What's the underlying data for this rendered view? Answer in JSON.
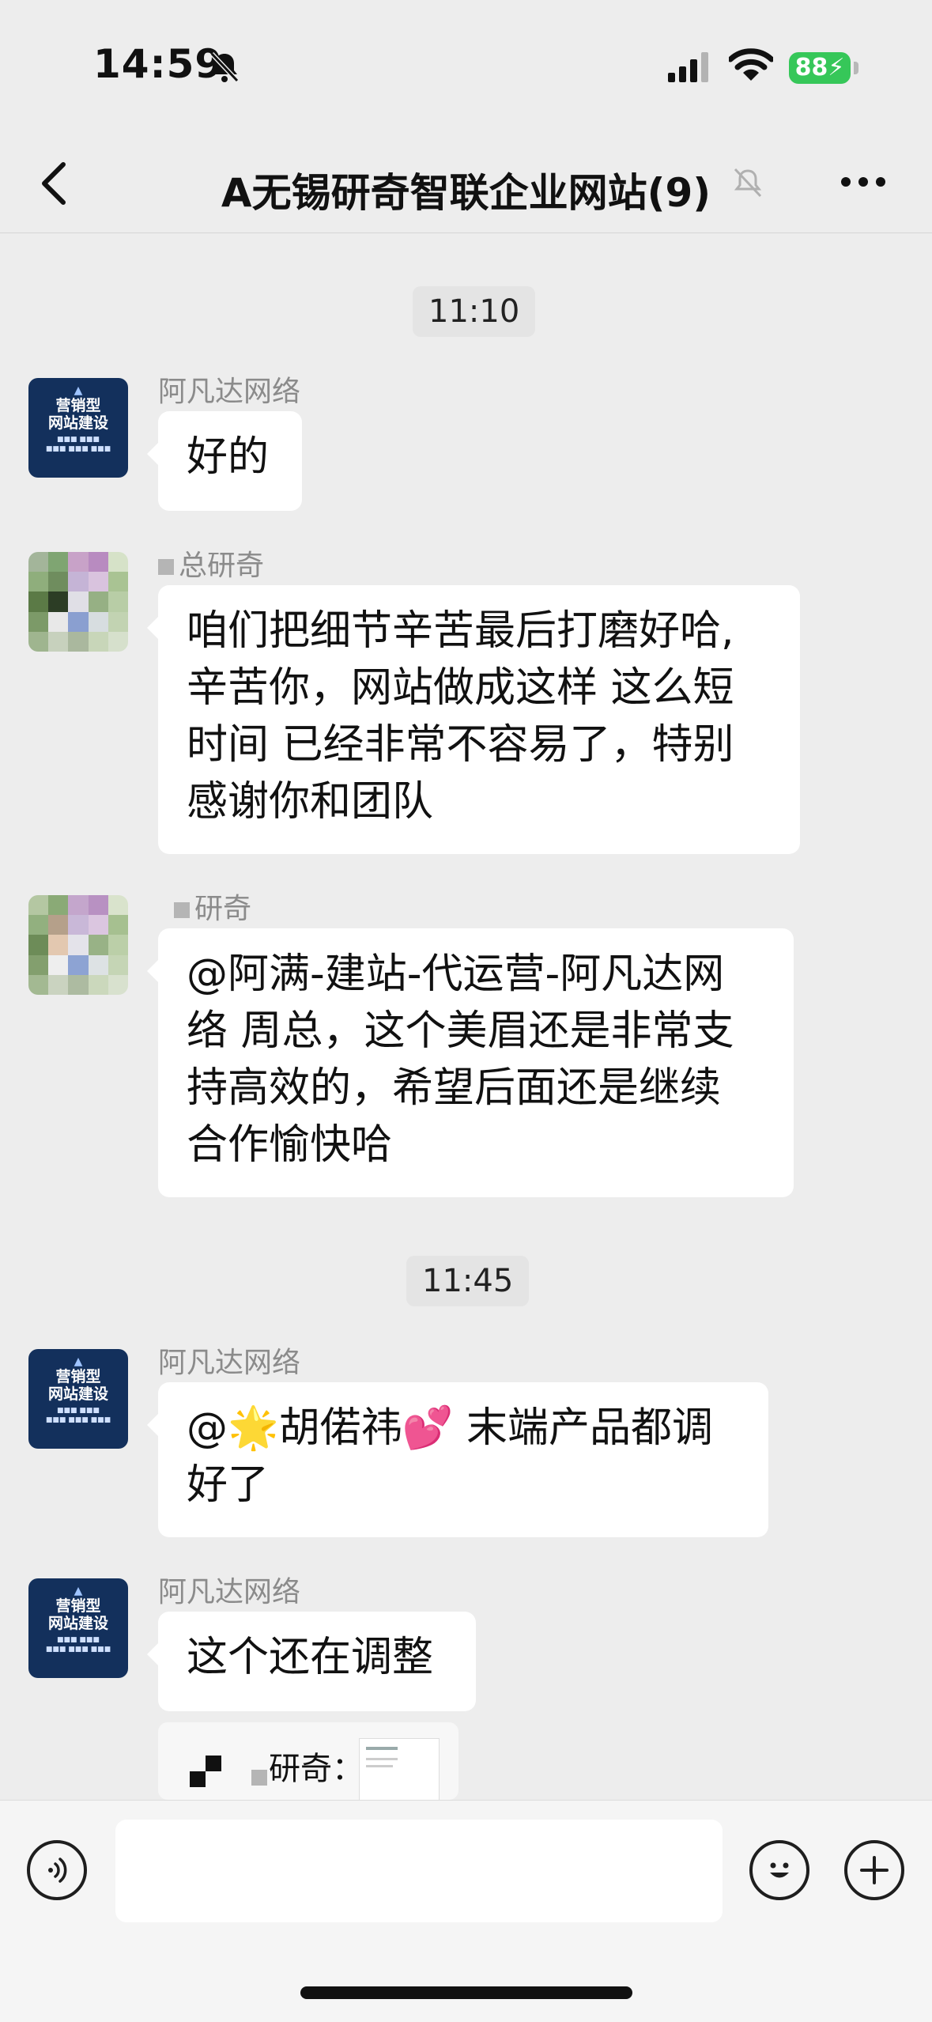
{
  "status_bar": {
    "time": "14:59",
    "battery": "88"
  },
  "header": {
    "title": "A无锡研奇智联企业网站(9)"
  },
  "timestamps": [
    "11:10",
    "11:45"
  ],
  "avatar_text": {
    "title": "营销型 网站建设",
    "logo": "阿凡达网络"
  },
  "messages": [
    {
      "sender": "阿凡达网络",
      "text": "好的"
    },
    {
      "sender": "总研奇",
      "lines": [
        "咱们把细节辛苦最后打磨好哈,",
        "辛苦你，网站做成这样 这么短",
        "时间 已经非常不容易了，特别",
        "感谢你和团队"
      ]
    },
    {
      "sender": "研奇",
      "lines": [
        "@阿满-建站-代运营-阿凡达网",
        "络 周总，这个美眉还是非常支",
        "持高效的，希望后面还是继续",
        "合作愉快哈"
      ]
    },
    {
      "sender": "阿凡达网络",
      "lines": [
        "@🌟胡偌祎💕 末端产品都调",
        "好了"
      ]
    },
    {
      "sender": "阿凡达网络",
      "text": "这个还在调整"
    },
    {
      "quote": "研奇："
    }
  ],
  "icons": [
    "bell-off-icon",
    "signal-icon",
    "wifi-icon",
    "back-icon",
    "more-icon",
    "voice-icon",
    "emoji-icon",
    "plus-icon"
  ]
}
